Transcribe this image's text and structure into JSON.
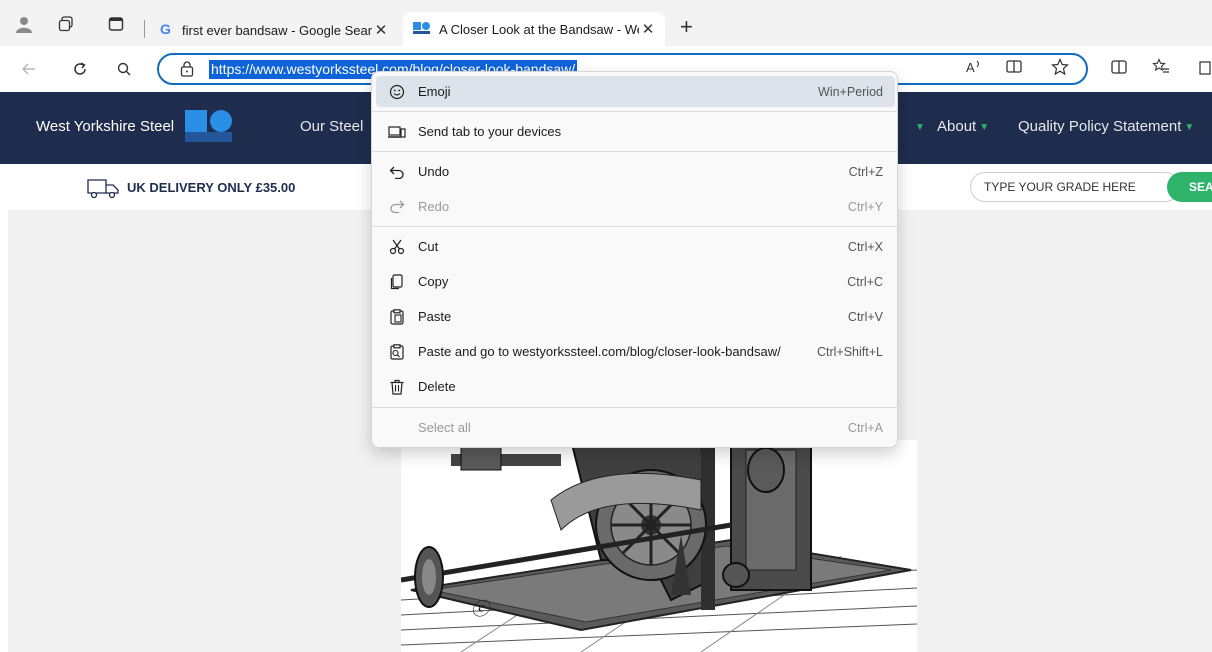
{
  "tabs": {
    "inactive_title": "first ever bandsaw - Google Search",
    "active_title": "A Closer Look at the Bandsaw - West Yorkshire Steel"
  },
  "address": {
    "url": "https://www.westyorkssteel.com/blog/closer-look-bandsaw/"
  },
  "site": {
    "brand": "West Yorkshire Steel",
    "nav": {
      "our_steel": "Our Steel",
      "about": "About",
      "quality": "Quality Policy Statement"
    },
    "delivery": "UK DELIVERY ONLY £35.00",
    "grade_placeholder": "TYPE YOUR GRADE HERE",
    "search_label": "SEA"
  },
  "context_menu": {
    "emoji": {
      "label": "Emoji",
      "shortcut": "Win+Period",
      "icon": "smiley-icon"
    },
    "send_tab": {
      "label": "Send tab to your devices",
      "icon": "devices-icon"
    },
    "undo": {
      "label": "Undo",
      "shortcut": "Ctrl+Z",
      "icon": "undo-icon"
    },
    "redo": {
      "label": "Redo",
      "shortcut": "Ctrl+Y",
      "icon": "redo-icon"
    },
    "cut": {
      "label": "Cut",
      "shortcut": "Ctrl+X",
      "icon": "scissors-icon"
    },
    "copy": {
      "label": "Copy",
      "shortcut": "Ctrl+C",
      "icon": "copy-icon"
    },
    "paste": {
      "label": "Paste",
      "shortcut": "Ctrl+V",
      "icon": "paste-icon"
    },
    "paste_go": {
      "label": "Paste and go to westyorkssteel.com/blog/closer-look-bandsaw/",
      "shortcut": "Ctrl+Shift+L",
      "icon": "paste-go-icon"
    },
    "delete": {
      "label": "Delete",
      "icon": "trash-icon"
    },
    "select_all": {
      "label": "Select all",
      "shortcut": "Ctrl+A"
    }
  },
  "colors": {
    "site_header": "#1e2d4e",
    "accent_blue": "#2b8ee6",
    "accent_green": "#2fb36b",
    "selection": "#0e63d8"
  }
}
